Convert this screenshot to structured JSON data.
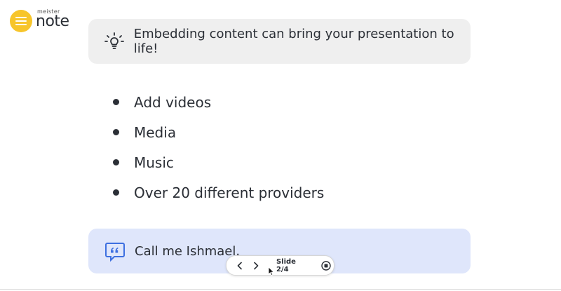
{
  "logo": {
    "small": "meister",
    "big": "note"
  },
  "callouts": {
    "tip": {
      "icon": "lightbulb-icon",
      "text": "Embedding content can bring your presentation to life!"
    },
    "quote": {
      "icon": "quote-icon",
      "text": "Call me Ishmael."
    }
  },
  "bullets": [
    {
      "label": "Add videos"
    },
    {
      "label": "Media"
    },
    {
      "label": "Music"
    },
    {
      "label": "Over 20 different providers"
    }
  ],
  "controls": {
    "slide_label": "Slide 2/4"
  },
  "colors": {
    "brand_yellow": "#f7c52b",
    "quote_bg": "#dfe6fb",
    "quote_icon": "#3d6fe0",
    "tip_bg": "#efefef"
  }
}
